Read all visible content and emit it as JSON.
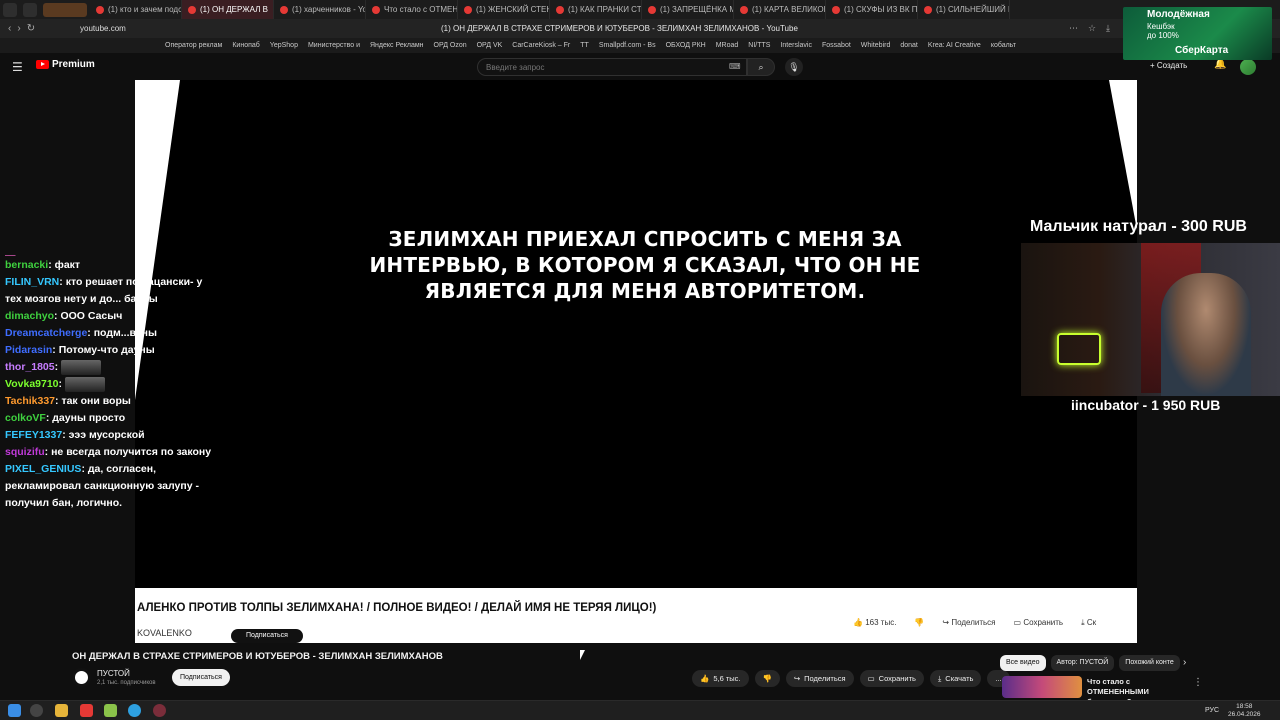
{
  "browser": {
    "tabs": [
      "(1) кто и зачем подсады",
      "(1) ОН ДЕРЖАЛ В",
      "(1) харченников - YouTu",
      "Что стало с ОТМЕНЕН",
      "(1) ЖЕНСКИЙ СТЕНДАП",
      "(1) КАК ПРАНКИ СТАЛИ",
      "(1) ЗАПРЕЩЁНКА МЕСС",
      "(1) КАРТА ВЕЛИКОГО П",
      "(1) СКУФЫ ИЗ ВК ПРОБ",
      "(1) СИЛЬНЕЙШИЙ РОГ"
    ],
    "active_tab_index": 1,
    "url": "youtube.com",
    "page_title": "(1) ОН ДЕРЖАЛ В СТРАХЕ СТРИМЕРОВ И ЮТУБЕРОВ - ЗЕЛИМХАН ЗЕЛИМХАНОВ - YouTube",
    "bookmarks": [
      "Оператор реклам",
      "Кинопаб",
      "YepShop",
      "Министерство и",
      "Яндекс Рекламн",
      "ОРД Ozon",
      "ОРД VK",
      "CarCareKiosk – Fr",
      "TT",
      "Smallpdf.com - Bs",
      "ОБХОД РКН",
      "MRoad",
      "NI/TTS",
      "Interslavic",
      "Fossabot",
      "Whitebird",
      "donat",
      "Krea: AI Creative",
      "кобальт"
    ]
  },
  "masthead": {
    "logo_text": "Premium",
    "search_placeholder": "Введите запрос",
    "create_label": "Создать"
  },
  "video": {
    "caption": "ЗЕЛИМХАН ПРИЕХАЛ СПРОСИТЬ С МЕНЯ ЗА ИНТЕРВЬЮ, В КОТОРОМ Я СКАЗАЛ, ЧТО ОН НЕ ЯВЛЯЕТСЯ ДЛЯ МЕНЯ АВТОРИТЕТОМ.",
    "inner_title": "АЛЕНКО ПРОТИВ ТОЛПЫ ЗЕЛИМХАНА! / ПОЛНОЕ ВИДЕО! / ДЕЛАЙ ИМЯ НЕ ТЕРЯЯ ЛИЦО!)",
    "inner_channel": "KOVALENKO",
    "inner_subscribe": "Подписаться",
    "inner_likes": "163 тыс.",
    "inner_share": "Поделиться",
    "inner_save": "Сохранить",
    "inner_download": "Ск"
  },
  "chat": [
    {
      "nick": "bernacki",
      "color": "#3fd13f",
      "text": "факт"
    },
    {
      "nick": "FILIN_VRN",
      "color": "#35c8ff",
      "text": "кто решает по пацански- у тех мозгов нету и до... баёбы"
    },
    {
      "nick": "dimachyo",
      "color": "#3fd13f",
      "text": "ООО Сасыч"
    },
    {
      "nick": "Dreamcatcherge",
      "color": "#3f6dff",
      "text": "подм...ваны"
    },
    {
      "nick": "Pidarasin",
      "color": "#3f6dff",
      "text": "Потому-что дауны"
    },
    {
      "nick": "thor_1805",
      "color": "#c77dff",
      "text": ""
    },
    {
      "nick": "Vovka9710",
      "color": "#7cff2e",
      "text": ""
    },
    {
      "nick": "Tachik337",
      "color": "#ff9a2e",
      "text": "так они воры"
    },
    {
      "nick": "colkoVF",
      "color": "#3fd13f",
      "text": "дауны просто"
    },
    {
      "nick": "FEFEY1337",
      "color": "#35c8ff",
      "text": "эээ мусорской"
    },
    {
      "nick": "squizifu",
      "color": "#c03ad8",
      "text": "не всегда получится по закону"
    },
    {
      "nick": "PIXEL_GENIUS",
      "color": "#35c8ff",
      "text": "да, согласен, рекламировал санкционную залупу - получил бан, логично."
    }
  ],
  "overlay": {
    "donation_1": "Мальчик натурал - 300 RUB",
    "donation_2": "iincubator - 1 950 RUB",
    "ad_line1": "Молодёжная",
    "ad_line2": "Кешбэк",
    "ad_line3": "до 100%",
    "ad_line4": "СберКарта"
  },
  "watch": {
    "title": "ОН ДЕРЖАЛ В СТРАХЕ СТРИМЕРОВ И ЮТУБЕРОВ - ЗЕЛИМХАН ЗЕЛИМХАНОВ",
    "channel": "ПУСТОЙ",
    "subscribers": "2,1 тыс. подписчиков",
    "subscribe": "Подписаться",
    "likes": "5,6 тыс.",
    "share": "Поделиться",
    "save": "Сохранить",
    "download": "Скачать",
    "more": "...",
    "chips": [
      "Все видео",
      "Автор: ПУСТОЙ",
      "Похожий конте"
    ],
    "rec_title": "Что стало с ОТМЕНЕННЫМИ блогерами?"
  },
  "taskbar": {
    "lang": "РУС",
    "time": "18:58",
    "date": "26.04.2026"
  }
}
